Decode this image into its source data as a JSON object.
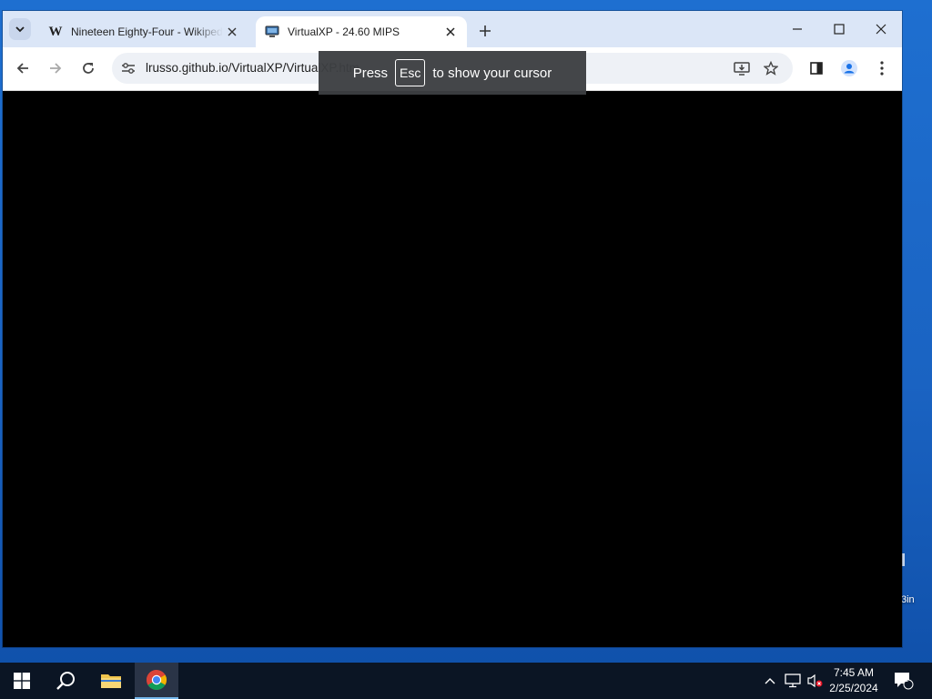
{
  "desktop": {
    "icon_label_partial": "3in"
  },
  "browser": {
    "tabs": [
      {
        "title": "Nineteen Eighty-Four - Wikipedia",
        "favicon": "wikipedia-icon",
        "favicon_text": "W",
        "active": false
      },
      {
        "title": "VirtualXP - 24.60 MIPS",
        "favicon": "monitor-icon",
        "active": true
      }
    ],
    "address": {
      "url": "lrusso.github.io/VirtualXP/VirtualXP.htm"
    },
    "fullscreen_notice": {
      "prefix": "Press",
      "key": "Esc",
      "suffix": "to show your cursor"
    },
    "colors": {
      "tabstrip": "#dbe6f7",
      "viewport": "#000000",
      "accent": "#1a73e8"
    }
  },
  "taskbar": {
    "clock": {
      "time": "7:45 AM",
      "date": "2/25/2024"
    },
    "notification_count": "1",
    "apps": [
      "start-icon",
      "search-icon",
      "file-explorer-icon",
      "chrome-icon"
    ]
  }
}
